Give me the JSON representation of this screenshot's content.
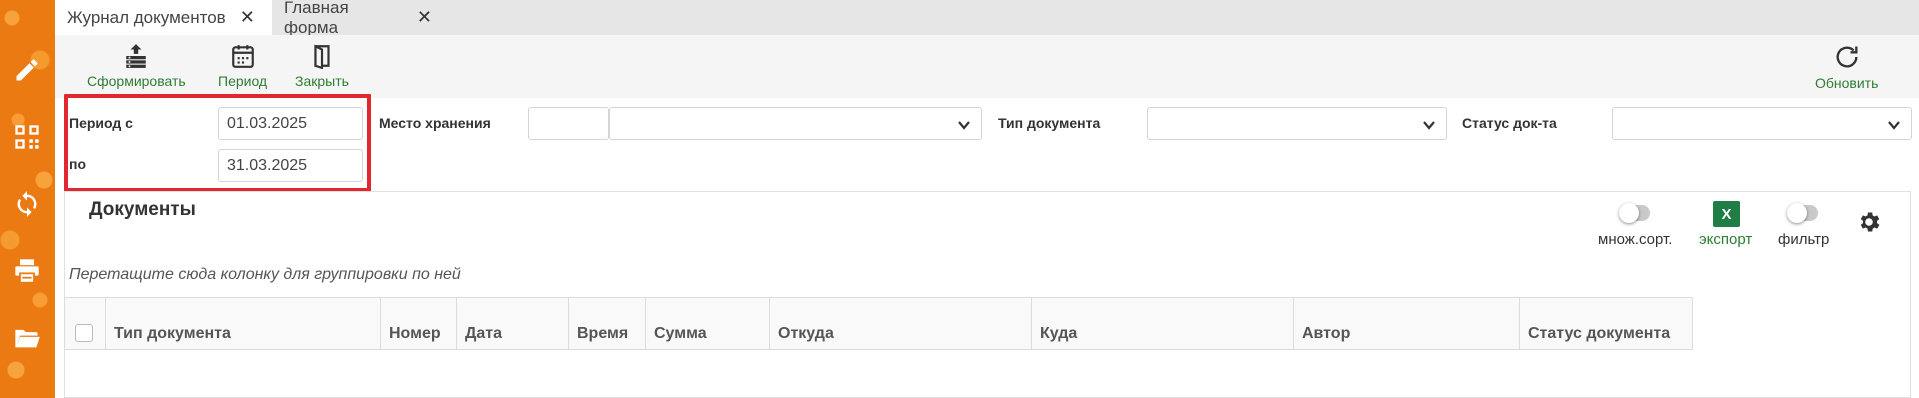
{
  "tabs": [
    {
      "label": "Журнал документов"
    },
    {
      "label": "Главная форма"
    }
  ],
  "toolbar": {
    "form_label": "Сформировать",
    "period_label": "Период",
    "close_label": "Закрыть",
    "refresh_label": "Обновить"
  },
  "filters": {
    "period_from_label": "Период с",
    "period_from_value": "01.03.2025",
    "period_to_label": "по",
    "period_to_value": "31.03.2025",
    "storage_label": "Место хранения",
    "doc_type_label": "Тип документа",
    "doc_status_label": "Статус док-та"
  },
  "documents": {
    "title": "Документы",
    "multisort_label": "множ.сорт.",
    "export_label": "экспорт",
    "filter_label": "фильтр",
    "excel_glyph": "X",
    "group_hint": "Перетащите сюда колонку для группировки по ней",
    "columns": [
      "Тип документа",
      "Номер",
      "Дата",
      "Время",
      "Сумма",
      "Откуда",
      "Куда",
      "Автор",
      "Статус документа"
    ]
  },
  "colors": {
    "accent_green": "#2e7d32",
    "rail_orange": "#ec7a12",
    "highlight_red": "#e0282e",
    "excel_green": "#1e7e45"
  },
  "icons": {
    "rail": [
      "pencil-icon",
      "qr-code-icon",
      "sync-icon",
      "print-icon",
      "folder-icon"
    ],
    "toolbar": [
      "upload-stack-icon",
      "calendar-icon",
      "door-icon",
      "refresh-icon"
    ]
  }
}
